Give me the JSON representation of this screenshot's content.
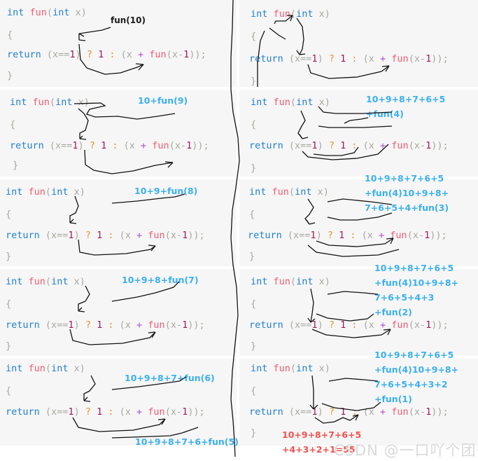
{
  "meta": {
    "bg_color": "#ffffff",
    "panel_color": "#f6f6f6",
    "annotation_blue": "#3ab0f0",
    "annotation_red": "#ef5350",
    "ink_color": "#111111"
  },
  "code": {
    "signature": "int fun(int x)",
    "open_brace": "{",
    "return_line": "return (x==1) ? 1 : (x + fun(x-1));",
    "close_brace": "}",
    "tokens": {
      "int": "int",
      "fun": "fun",
      "return": "return",
      "x": "x",
      "eq": "==",
      "one": "1",
      "question": "?",
      "colon": ":",
      "plus": "+",
      "minus_one": "x-1",
      "semicolon": ";"
    }
  },
  "left_column": {
    "blocks": [
      {
        "id": "block-l1",
        "annotation": "fun(10)",
        "annotation_color": "black"
      },
      {
        "id": "block-l2",
        "annotation": "10+fun(9)",
        "annotation_color": "blue"
      },
      {
        "id": "block-l3",
        "annotation": "10+9+fun(8)",
        "annotation_color": "blue"
      },
      {
        "id": "block-l4",
        "annotation": "10+9+8+fun(7)",
        "annotation_color": "blue"
      },
      {
        "id": "block-l5",
        "annotation": "10+9+8+7+fun(6)",
        "annotation_color": "blue"
      }
    ],
    "footer_annotation": "10+9+8+7+6+fun(5)",
    "footer_annotation_color": "blue"
  },
  "right_column": {
    "blocks": [
      {
        "id": "block-r1",
        "annotation_lines": [],
        "annotation_color": "blue"
      },
      {
        "id": "block-r2",
        "annotation_lines": [
          "10+9+8+7+6+5",
          "+fun(4)"
        ],
        "annotation_color": "blue"
      },
      {
        "id": "block-r3",
        "annotation_lines": [
          "10+9+8+7+6+5",
          "+fun(4)10+9+8+",
          "7+6+5+4+fun(3)"
        ],
        "annotation_color": "blue"
      },
      {
        "id": "block-r4",
        "annotation_lines": [
          "10+9+8+7+6+5",
          "+fun(4)10+9+8+",
          "7+6+5+4+3",
          "+fun(2)"
        ],
        "annotation_color": "blue"
      },
      {
        "id": "block-r5",
        "annotation_lines": [
          "10+9+8+7+6+5",
          "+fun(4)10+9+8+",
          "7+6+5+4+3+2",
          "+fun(1)"
        ],
        "annotation_color": "blue"
      }
    ],
    "result_lines": [
      "10+9+8+7+6+5",
      "+4+3+2+1=55"
    ],
    "result_color": "red"
  },
  "watermark": {
    "text": "CSDN @一口吖个团子"
  }
}
